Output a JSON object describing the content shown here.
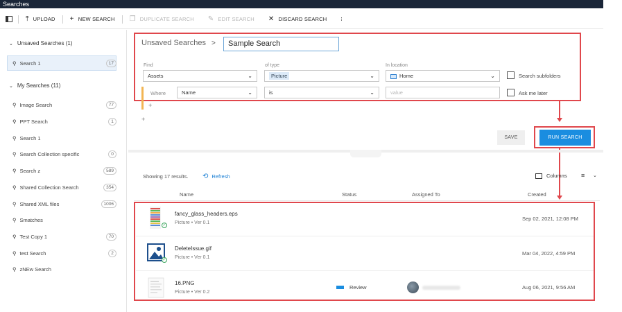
{
  "window": {
    "title": "Searches"
  },
  "toolbar": {
    "upload": "UPLOAD",
    "new_search": "NEW SEARCH",
    "duplicate_search": "DUPLICATE SEARCH",
    "edit_search": "EDIT SEARCH",
    "discard_search": "DISCARD SEARCH",
    "more": "⁝"
  },
  "sidebar": {
    "unsaved_group": "Unsaved Searches (1)",
    "unsaved_items": [
      {
        "label": "Search 1",
        "count": "17"
      }
    ],
    "my_group": "My Searches (11)",
    "my_items": [
      {
        "label": "Image Search",
        "count": "77"
      },
      {
        "label": "PPT Search",
        "count": "1"
      },
      {
        "label": "Search 1",
        "count": ""
      },
      {
        "label": "Search Collection specific",
        "count": "0"
      },
      {
        "label": "Search z",
        "count": "589"
      },
      {
        "label": "Shared Collection Search",
        "count": "354"
      },
      {
        "label": "Shared XML files",
        "count": "1006"
      },
      {
        "label": "Smatches",
        "count": ""
      },
      {
        "label": "Test Copy 1",
        "count": "70"
      },
      {
        "label": "test Search",
        "count": "2"
      },
      {
        "label": "zNEw Search",
        "count": ""
      }
    ]
  },
  "editor": {
    "breadcrumb_parent": "Unsaved Searches",
    "breadcrumb_sep": ">",
    "search_name": "Sample Search",
    "find_label": "Find",
    "find_value": "Assets",
    "type_label": "of type",
    "type_value": "Picture",
    "location_label": "In location",
    "location_value": "Home",
    "search_subfolders": "Search subfolders",
    "where_label": "Where",
    "field_value": "Name",
    "operator_value": "is",
    "value_placeholder": "value",
    "ask_me_later": "Ask me later",
    "plus": "+",
    "save": "SAVE",
    "run_search": "RUN SEARCH"
  },
  "results": {
    "showing": "Showing 17 results.",
    "refresh": "Refresh",
    "columns": "Columns",
    "menu": "≡",
    "menu_caret": "⌄",
    "headers": {
      "name": "Name",
      "status": "Status",
      "assigned_to": "Assigned To",
      "created": "Created"
    },
    "rows": [
      {
        "name": "fancy_glass_headers.eps",
        "type": "Picture",
        "version": "Ver 0.1",
        "status": "",
        "created": "Sep 02, 2021, 12:08 PM"
      },
      {
        "name": "DeleteIssue.gif",
        "type": "Picture",
        "version": "Ver 0.1",
        "status": "",
        "created": "Mar 04, 2022, 4:59 PM"
      },
      {
        "name": "16.PNG",
        "type": "Picture",
        "version": "Ver 0.2",
        "status": "Review",
        "created": "Aug 06, 2021, 9:56 AM"
      }
    ]
  },
  "colors": {
    "accent": "#1a8de0",
    "highlight_border": "#e0474c",
    "titlebar": "#1a2638"
  }
}
